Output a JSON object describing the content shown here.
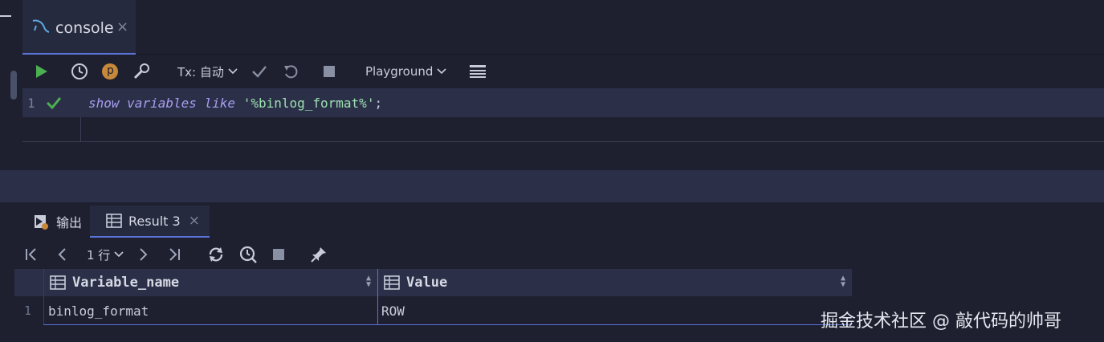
{
  "tabs": [
    {
      "label": "console",
      "close": "×"
    }
  ],
  "toolbar": {
    "tx_label": "Tx: 自动",
    "playground_label": "Playground",
    "p_badge": "p"
  },
  "editor": {
    "line_number": "1",
    "code": {
      "kw_show": "show",
      "kw_variables": "variables",
      "kw_like": "like",
      "string": "'%binlog_format%'",
      "terminator": ";"
    }
  },
  "result_tabs": [
    {
      "label": "输出"
    },
    {
      "label": "Result 3",
      "close": "×"
    }
  ],
  "result_toolbar": {
    "rows_label": "1 行"
  },
  "grid": {
    "columns": [
      {
        "label": "Variable_name"
      },
      {
        "label": "Value"
      }
    ],
    "rows": [
      {
        "num": "1",
        "cells": [
          "binlog_format",
          "ROW"
        ]
      }
    ]
  },
  "watermark": "掘金技术社区 @ 敲代码的帅哥",
  "colors": {
    "accent": "#5a74d8",
    "run": "#4caf50",
    "check": "#4caf50",
    "badge": "#c8883a"
  }
}
